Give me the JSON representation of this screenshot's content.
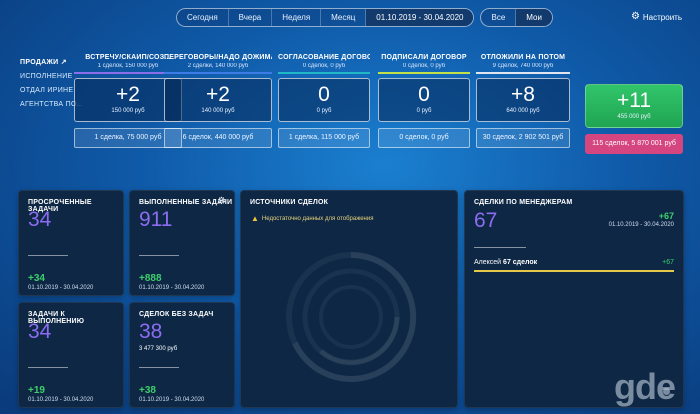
{
  "filters": {
    "periods": [
      "Сегодня",
      "Вчера",
      "Неделя",
      "Месяц",
      "01.10.2019 - 30.04.2020"
    ],
    "scope": [
      "Все",
      "Мои"
    ],
    "settings_label": "Настроить"
  },
  "sidebar": {
    "items": [
      "ПРОДАЖИ",
      "ИСПОЛНЕНИЕ",
      "ОТДАЛ ИРИНЕ",
      "АГЕНТСТВА ПО..."
    ],
    "ext_icon": "↗"
  },
  "funnel": [
    {
      "title": "ВСТРЕЧУ/СКАЙП/СОЗ...",
      "subtitle": "1 сделок, 150 000 руб",
      "value": "+2",
      "money": "150 000 руб",
      "footer": "1 сделка, 75 000 руб",
      "color": "#8b6fe8"
    },
    {
      "title": "ПЕРЕГОВОРЫ/НАДО ДОЖИМАТЬ",
      "subtitle": "2 сделки, 140 000 руб",
      "value": "+2",
      "money": "140 000 руб",
      "footer": "6 сделок, 440 000 руб",
      "color": "#3d7be6"
    },
    {
      "title": "СОГЛАСОВАНИЕ ДОГОВОРА",
      "subtitle": "0 сделок, 0 руб",
      "value": "0",
      "money": "0 руб",
      "footer": "1 сделка, 115 000 руб",
      "color": "#20b8c8"
    },
    {
      "title": "ПОДПИСАЛИ ДОГОВОР",
      "subtitle": "0 сделок, 0 руб",
      "value": "0",
      "money": "0 руб",
      "footer": "0 сделок, 0 руб",
      "color": "#c2e04a"
    },
    {
      "title": "ОТЛОЖИЛИ НА ПОТОМ",
      "subtitle": "9 сделок, 740 000 руб",
      "value": "+8",
      "money": "640 000 руб",
      "footer": "30 сделок, 2 902 501 руб",
      "color": "#dfe6ef"
    }
  ],
  "total": {
    "value": "+11",
    "money": "455 000 руб",
    "footer": "115 сделок, 5 870 001 руб"
  },
  "cards": {
    "overdue": {
      "title": "ПРОСРОЧЕННЫЕ ЗАДАЧИ",
      "value": "34",
      "delta": "+34",
      "range": "01.10.2019 - 30.04.2020"
    },
    "done": {
      "title": "ВЫПОЛНЕННЫЕ ЗАДАЧИ",
      "value": "911",
      "delta": "+888",
      "range": "01.10.2019 - 30.04.2020"
    },
    "todo": {
      "title": "ЗАДАЧИ К ВЫПОЛНЕНИЮ",
      "value": "34",
      "delta": "+19",
      "range": "01.10.2019 - 30.04.2020"
    },
    "notasks": {
      "title": "СДЕЛОК БЕЗ ЗАДАЧ",
      "value": "38",
      "money": "3 477 300 руб",
      "delta": "+38",
      "range": "01.10.2019 - 30.04.2020"
    },
    "sources": {
      "title": "ИСТОЧНИКИ СДЕЛОК",
      "warning": "Недостаточно данных для отображения"
    },
    "managers": {
      "title": "СДЕЛКИ ПО МЕНЕДЖЕРАМ",
      "value": "67",
      "delta": "+67",
      "range": "01.10.2019 - 30.04.2020",
      "manager": "Алексей",
      "manager_deals": "67 сделок",
      "manager_delta": "+67"
    }
  },
  "watermark": "gde"
}
